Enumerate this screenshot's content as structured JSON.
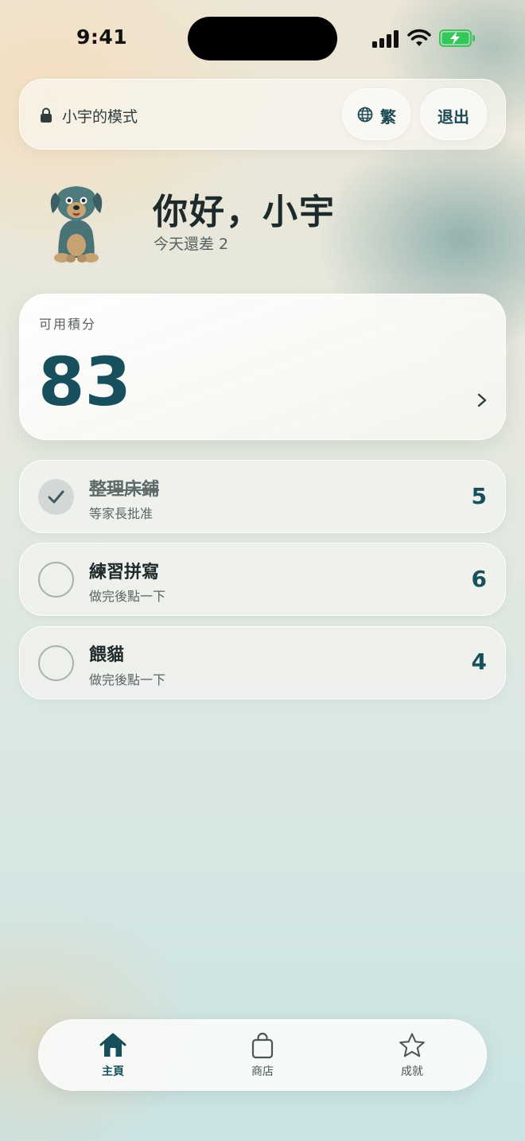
{
  "status_bar": {
    "time": "9:41"
  },
  "header": {
    "mode_label": "小宇的模式",
    "lang_label": "繁",
    "logout_label": "退出"
  },
  "greeting": {
    "title": "你好，小宇",
    "subtitle": "今天還差 2"
  },
  "points": {
    "label": "可用積分",
    "value": "83"
  },
  "tasks": [
    {
      "title": "整理床鋪",
      "subtitle": "等家長批准",
      "points": "5",
      "status": "pending-approval"
    },
    {
      "title": "練習拼寫",
      "subtitle": "做完後點一下",
      "points": "6",
      "status": "open"
    },
    {
      "title": "餵貓",
      "subtitle": "做完後點一下",
      "points": "4",
      "status": "open"
    }
  ],
  "nav": [
    {
      "label": "主頁",
      "icon": "home-icon",
      "active": true
    },
    {
      "label": "商店",
      "icon": "shopping-bag-icon",
      "active": false
    },
    {
      "label": "成就",
      "icon": "star-icon",
      "active": false
    }
  ],
  "colors": {
    "accent": "#17505c",
    "battery_green": "#34c759"
  }
}
